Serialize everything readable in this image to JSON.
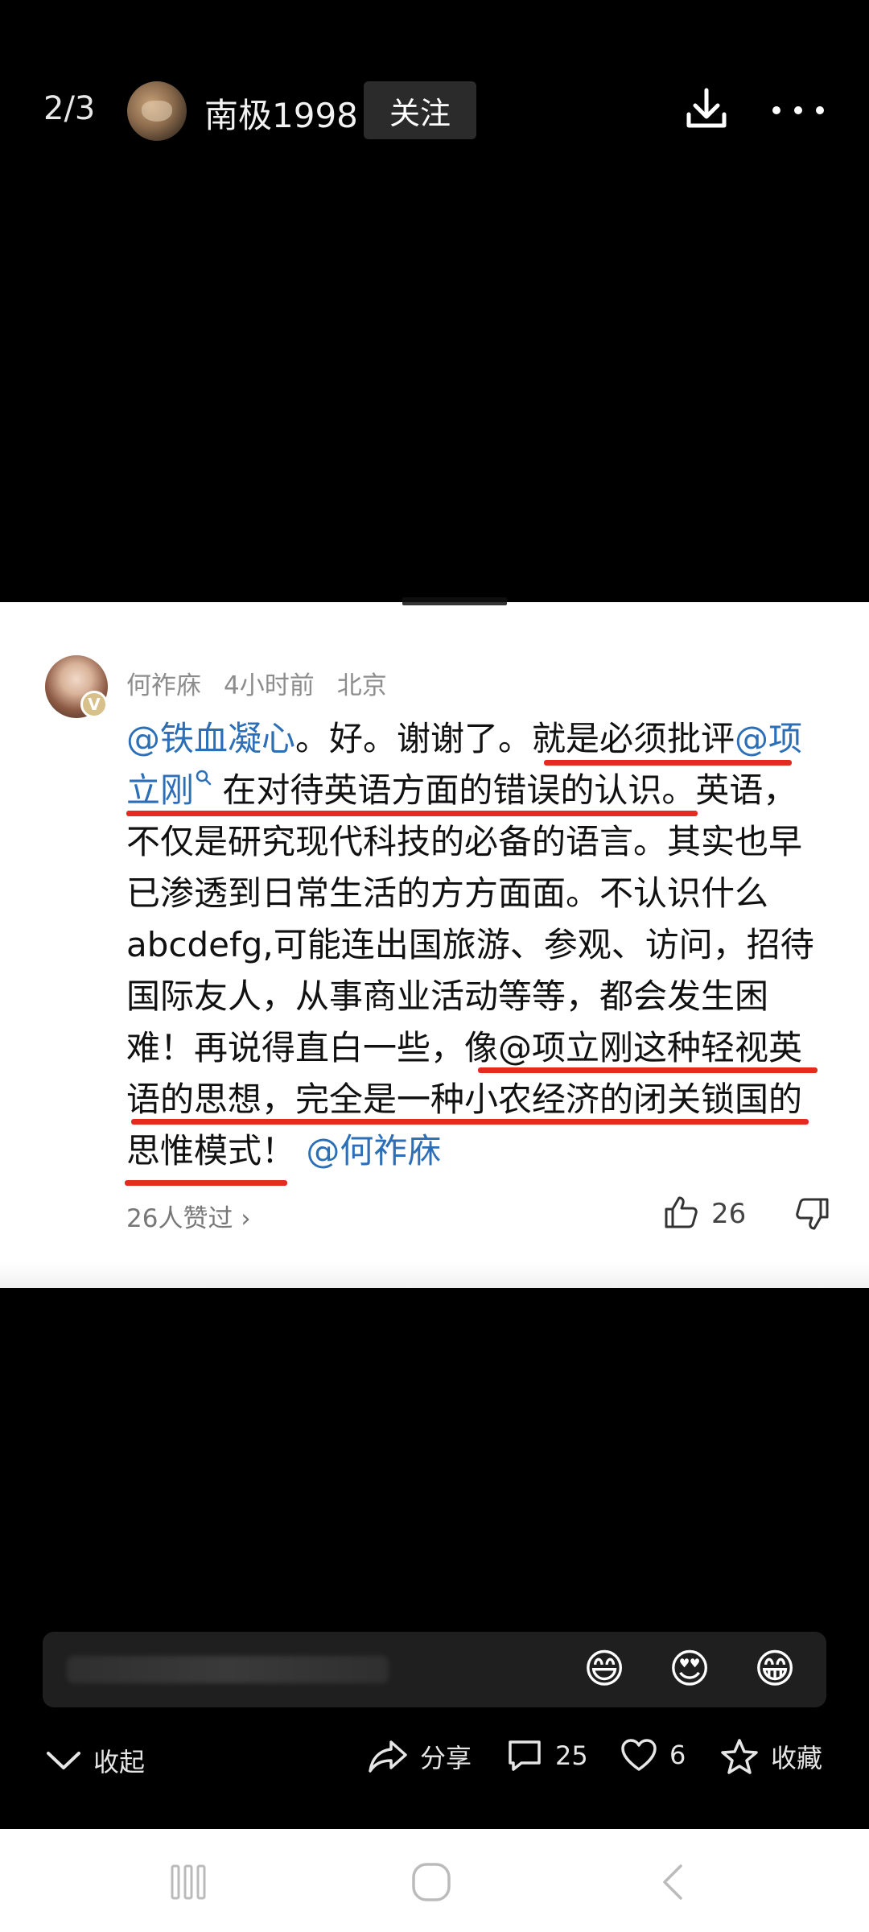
{
  "topbar": {
    "page_count": "2/3",
    "username": "南极1998",
    "follow_label": "关注"
  },
  "comment": {
    "author": "何祚庥",
    "time": "4小时前",
    "location": "北京",
    "badge": "V",
    "text": {
      "mention1": "@铁血凝心",
      "t1": "。好。谢谢了。就是必须批评",
      "mention2a": "@项",
      "mention2b": "立刚",
      "t2": "在对待英语方面的错误的认识。英语，",
      "line3": "不仅是研究现代科技的必备的语言。其实也早",
      "line4": "已渗透到日常生活的方方面面。不认识什么",
      "line5": "abcdefg,可能连出国旅游、参观、访问，招待",
      "line6": "国际友人，从事商业活动等等，都会发生困",
      "t3": "难！再说得直白一些，像",
      "mention3": "@项立刚",
      "t4": "这种轻视英",
      "line8": "语的思想，完全是一种小农经济的闭关锁国的",
      "t5": "思惟模式！",
      "mention4": "@何祚庥"
    },
    "likes_text": "26人赞过 ›",
    "like_count": "26"
  },
  "input": {
    "emojis": [
      "😄",
      "😍",
      "😁"
    ]
  },
  "actions": {
    "collapse": "收起",
    "share": "分享",
    "comments": "25",
    "likes": "6",
    "favorite": "收藏"
  },
  "colors": {
    "link": "#2c6fb7",
    "underline": "#e32b1f"
  }
}
